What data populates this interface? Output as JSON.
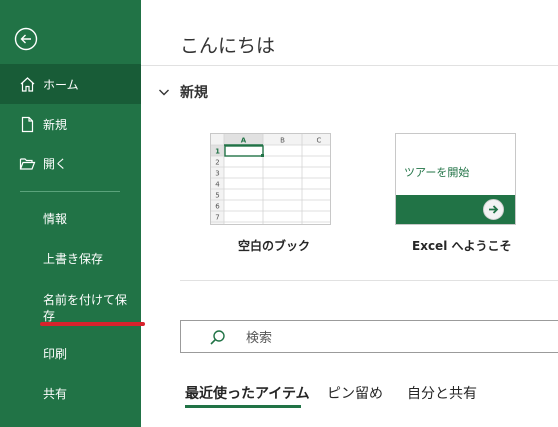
{
  "sidebar": {
    "items": [
      {
        "label": "ホーム"
      },
      {
        "label": "新規"
      },
      {
        "label": "開く"
      }
    ],
    "sub_items": [
      {
        "label": "情報"
      },
      {
        "label": "上書き保存"
      },
      {
        "label": "名前を付けて保存"
      },
      {
        "label": "印刷"
      },
      {
        "label": "共有"
      }
    ]
  },
  "main": {
    "greeting": "こんにちは",
    "new_section": {
      "title": "新規"
    },
    "templates": [
      {
        "label": "空白のブック"
      },
      {
        "label": "Excel へようこそ",
        "tile_text": "ツアーを開始"
      }
    ],
    "grid_headers": [
      "A",
      "B",
      "C"
    ],
    "grid_rows": [
      "1",
      "2",
      "3",
      "4",
      "5",
      "6",
      "7"
    ],
    "search": {
      "placeholder": "検索"
    },
    "tabs": [
      {
        "label": "最近使ったアイテム"
      },
      {
        "label": "ピン留め"
      },
      {
        "label": "自分と共有"
      }
    ]
  },
  "colors": {
    "brand": "#217346",
    "brand_dark": "#185c37",
    "annotation_underline": "#d7232c"
  },
  "icons": [
    "back-arrow-icon",
    "home-icon",
    "new-document-icon",
    "open-folder-icon",
    "chevron-down-icon",
    "search-icon",
    "arrow-right-icon"
  ]
}
